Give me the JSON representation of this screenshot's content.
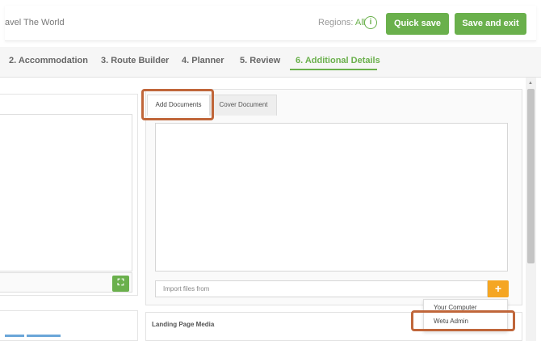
{
  "header": {
    "trip_title": "avel The World",
    "regions_label": "Regions:",
    "regions_value": "All",
    "info_glyph": "i",
    "quick_save_label": "Quick save",
    "save_exit_label": "Save and exit"
  },
  "steps": [
    {
      "label": "2. Accommodation",
      "active": false
    },
    {
      "label": "3. Route Builder",
      "active": false
    },
    {
      "label": "4. Planner",
      "active": false
    },
    {
      "label": "5. Review",
      "active": false
    },
    {
      "label": "6. Additional Details",
      "active": true
    }
  ],
  "documents": {
    "tabs": [
      {
        "label": "Add Documents",
        "selected": true
      },
      {
        "label": "Cover Document",
        "selected": false
      }
    ],
    "import_placeholder": "Import files from",
    "add_glyph": "+",
    "import_options": [
      "Your Computer",
      "Wetu Admin"
    ]
  },
  "landing": {
    "title": "Landing Page Media"
  },
  "icons": {
    "expand": "expand-icon",
    "info": "info-icon",
    "plus": "plus-icon"
  },
  "colors": {
    "accent_green": "#6ab04c",
    "accent_orange": "#f5a623",
    "highlight": "#c0663a"
  }
}
